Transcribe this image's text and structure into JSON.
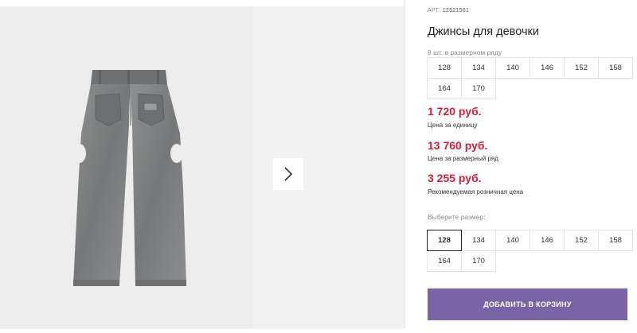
{
  "product": {
    "art_label": "АРТ:",
    "art_number": "12521561",
    "title": "Джинсы для девочки",
    "image_alt": "product-image",
    "next_icon": "chevron-right-icon"
  },
  "size_row": {
    "label": "8 шт. в размерном ряду",
    "sizes": [
      "128",
      "134",
      "140",
      "146",
      "152",
      "158",
      "164",
      "170"
    ]
  },
  "prices": [
    {
      "value": "1 720 руб.",
      "label": "Цена за единицу"
    },
    {
      "value": "13 760 руб.",
      "label": "Цена за размерный ряд"
    },
    {
      "value": "3 255 руб.",
      "label": "Рекомендуемая розничная цена"
    }
  ],
  "size_select": {
    "label": "Выберите размер:",
    "sizes": [
      "128",
      "134",
      "140",
      "146",
      "152",
      "158",
      "164",
      "170"
    ],
    "selected": "128"
  },
  "cart_button": {
    "label": "ДОБАВИТЬ В КОРЗИНУ"
  },
  "colors": {
    "price": "#d3203a",
    "button": "#7a64a6"
  }
}
